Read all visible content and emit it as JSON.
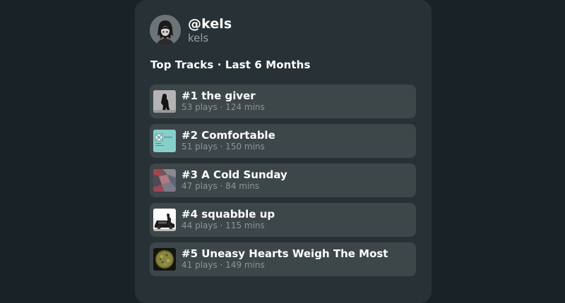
{
  "profile": {
    "handle": "@kels",
    "username": "kels"
  },
  "section_title": "Top Tracks · Last 6 Months",
  "tracks": [
    {
      "title": "#1 the giver",
      "meta": "53 plays · 124 mins",
      "cover_icon": "album-cover-the-giver"
    },
    {
      "title": "#2 Comfortable",
      "meta": "51 plays · 150 mins",
      "cover_icon": "album-cover-comfortable"
    },
    {
      "title": "#3 A Cold Sunday",
      "meta": "47 plays · 84 mins",
      "cover_icon": "album-cover-a-cold-sunday"
    },
    {
      "title": "#4 squabble up",
      "meta": "44 plays · 115 mins",
      "cover_icon": "album-cover-squabble-up"
    },
    {
      "title": "#5 Uneasy Hearts Weigh The Most",
      "meta": "41 plays · 149 mins",
      "cover_icon": "album-cover-uneasy-hearts"
    }
  ],
  "colors": {
    "page_background": "#192226",
    "card_background": "#283236",
    "row_background": "#3d4649",
    "primary_text": "#ffffff",
    "secondary_text": "#8c9498"
  }
}
